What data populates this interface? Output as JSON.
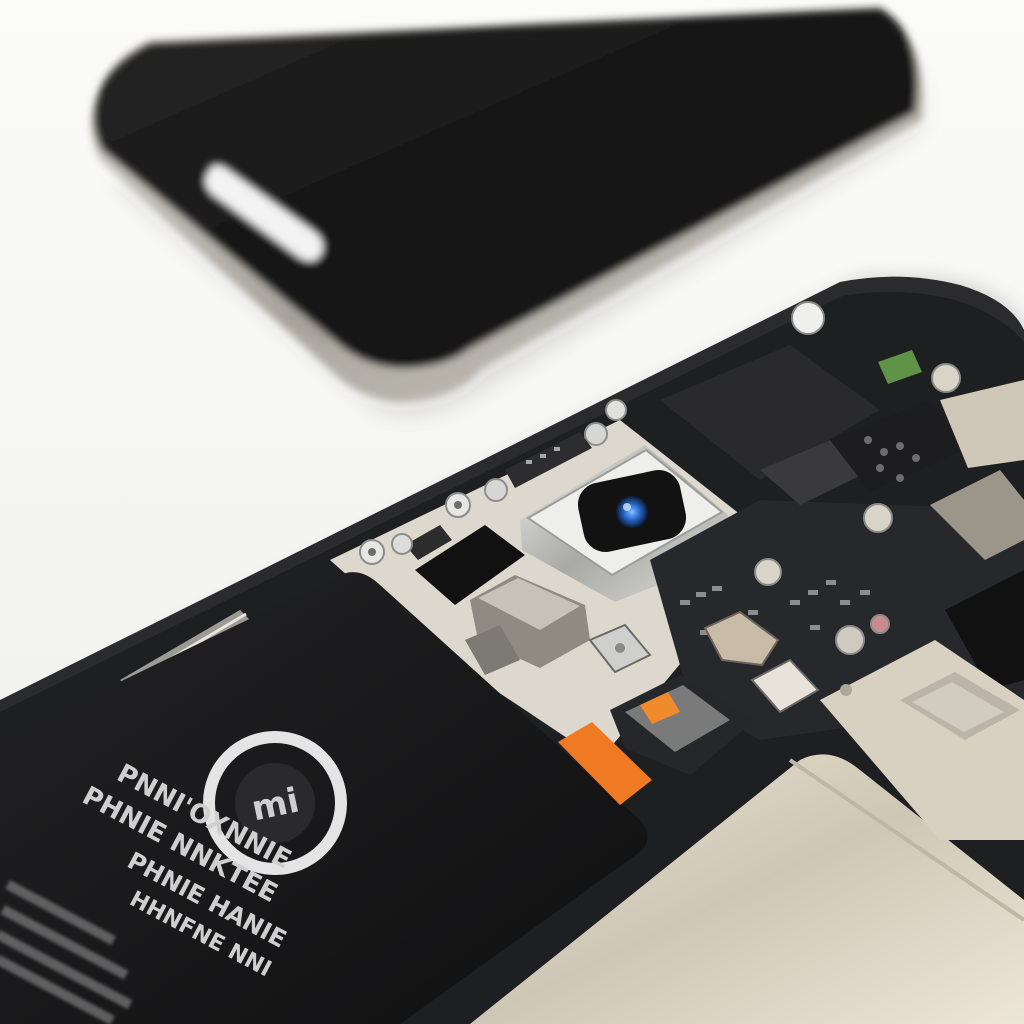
{
  "scene": {
    "type": "photo",
    "colors": {
      "background": "#f4f4f2",
      "phone_screen": "#141414",
      "phone_frame": "#b8b5ae",
      "battery": "#161617",
      "board": "#1e1f21",
      "shield": "#d9d2c2",
      "accent_connector": "#f07a24",
      "lens": "#2a6fd6"
    }
  },
  "battery": {
    "logo_glyph": "mi",
    "print_lines": [
      "PNNI'OXNNIE",
      "PHNIE NNKTEE",
      "PHNIE HANIE",
      "HHNFNE NNI"
    ]
  }
}
